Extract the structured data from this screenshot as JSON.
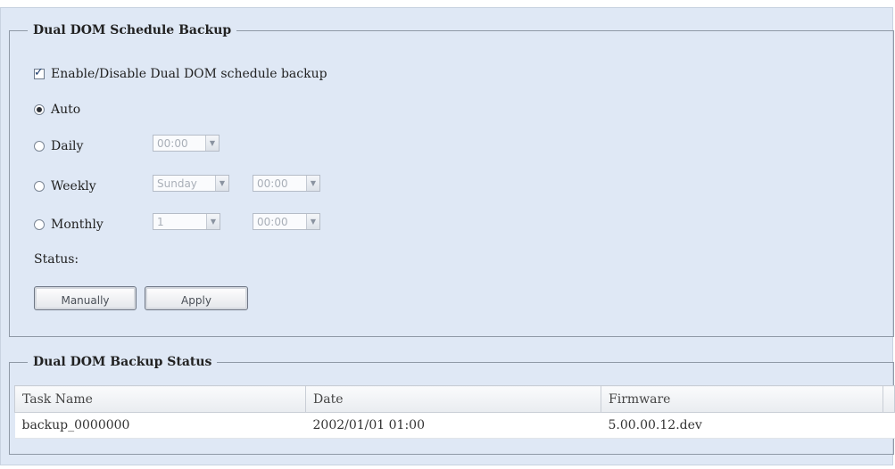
{
  "schedule": {
    "legend": "Dual DOM Schedule Backup",
    "enable_label": "Enable/Disable Dual DOM schedule backup",
    "enable_checked": true,
    "options": {
      "auto": "Auto",
      "daily": "Daily",
      "weekly": "Weekly",
      "monthly": "Monthly"
    },
    "selected": "auto",
    "daily_time": "00:00",
    "weekly_day": "Sunday",
    "weekly_time": "00:00",
    "monthly_day": "1",
    "monthly_time": "00:00",
    "status_label": "Status:",
    "manually_label": "Manually",
    "apply_label": "Apply"
  },
  "backup_status": {
    "legend": "Dual DOM Backup Status",
    "columns": [
      "Task Name",
      "Date",
      "Firmware"
    ],
    "rows": [
      {
        "task": "backup_0000000",
        "date": "2002/01/01 01:00",
        "firmware": "5.00.00.12.dev"
      }
    ]
  }
}
